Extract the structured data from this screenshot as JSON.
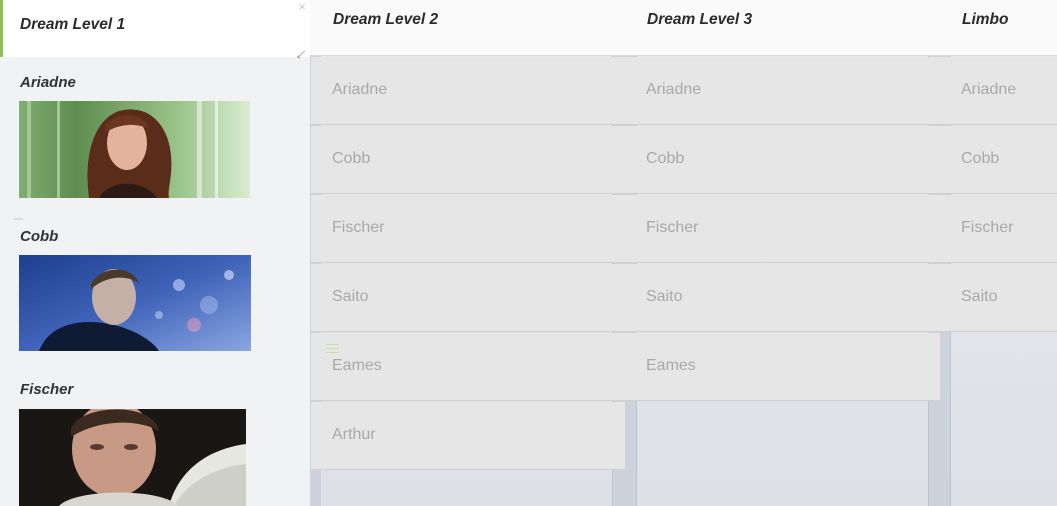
{
  "panel": {
    "title": "Dream Level 1",
    "characters": [
      {
        "name": "Ariadne",
        "image_icon": "ariadne-photo"
      },
      {
        "name": "Cobb",
        "image_icon": "cobb-photo"
      },
      {
        "name": "Fischer",
        "image_icon": "fischer-photo"
      }
    ]
  },
  "columns": [
    {
      "title": "Dream Level 2",
      "cells": [
        "Ariadne",
        "Cobb",
        "Fischer",
        "Saito",
        "Eames",
        "Arthur"
      ]
    },
    {
      "title": "Dream Level 3",
      "cells": [
        "Ariadne",
        "Cobb",
        "Fischer",
        "Saito",
        "Eames"
      ]
    },
    {
      "title": "Limbo",
      "cells": [
        "Ariadne",
        "Cobb",
        "Fischer",
        "Saito"
      ]
    }
  ],
  "colors": {
    "accent": "#8cc152",
    "row_background": "#e6e6e6",
    "row_text": "#a9a9a9"
  }
}
